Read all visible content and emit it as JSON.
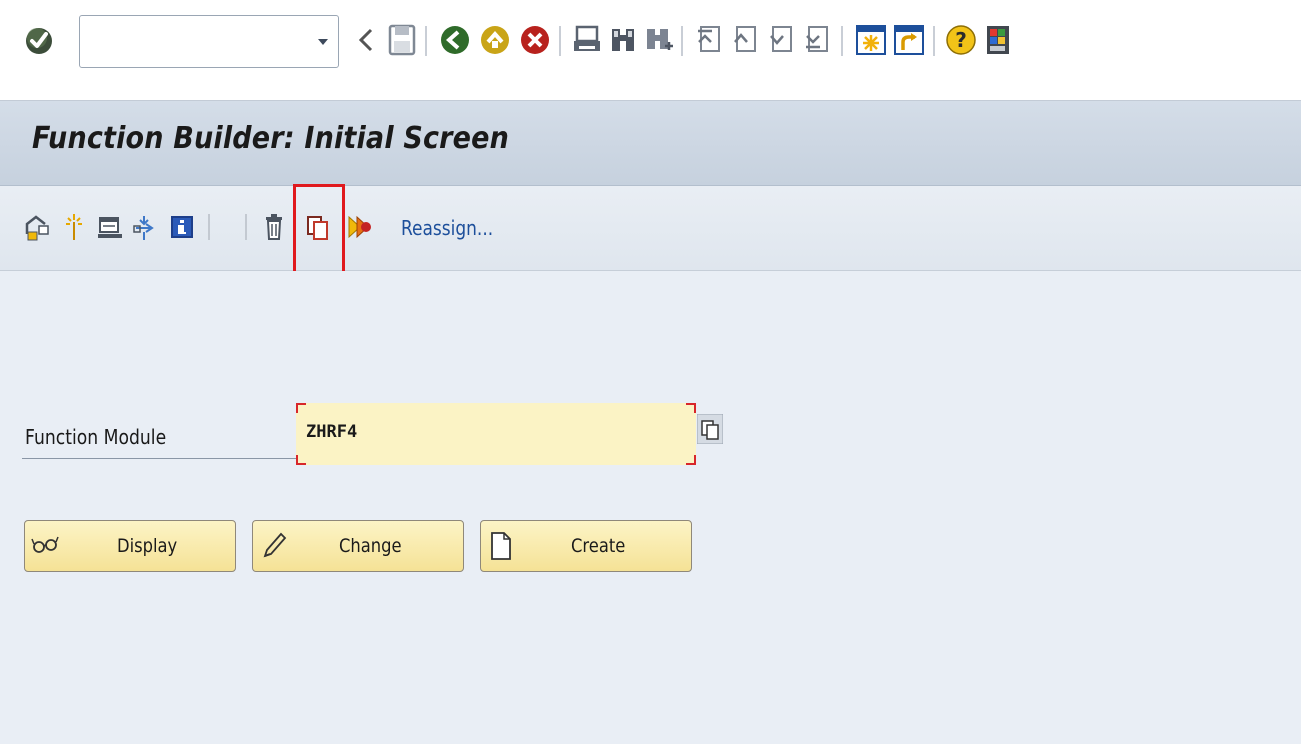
{
  "system_toolbar": {
    "command_field": {
      "value": "",
      "placeholder": ""
    },
    "icons": [
      "enter-icon",
      "back-icon",
      "save-icon",
      "back-green-icon",
      "exit-icon",
      "cancel-icon",
      "print-icon",
      "find-icon",
      "find-next-icon",
      "first-page-icon",
      "previous-page-icon",
      "next-page-icon",
      "last-page-icon",
      "new-session-icon",
      "shortcut-icon",
      "help-icon",
      "customize-layout-icon"
    ]
  },
  "title_bar": {
    "title": "Function Builder: Initial Screen"
  },
  "app_toolbar": {
    "icons": [
      "other-object-icon",
      "where-used-icon",
      "display-object-list-icon",
      "transport-icon",
      "info-icon",
      "delete-icon",
      "copy-icon",
      "rename-icon"
    ],
    "reassign_label": "Reassign..."
  },
  "form": {
    "function_module_label": "Function Module",
    "function_module_value": "ZHRF4"
  },
  "buttons": {
    "display_label": "Display",
    "change_label": "Change",
    "create_label": "Create"
  },
  "colors": {
    "title_bar_bg": "#c9d4e1",
    "main_bg": "#e9eef5",
    "button_bg": "#f5e296",
    "input_bg": "#fbf3c5",
    "highlight": "#e0191d",
    "link": "#1d4f9b"
  }
}
